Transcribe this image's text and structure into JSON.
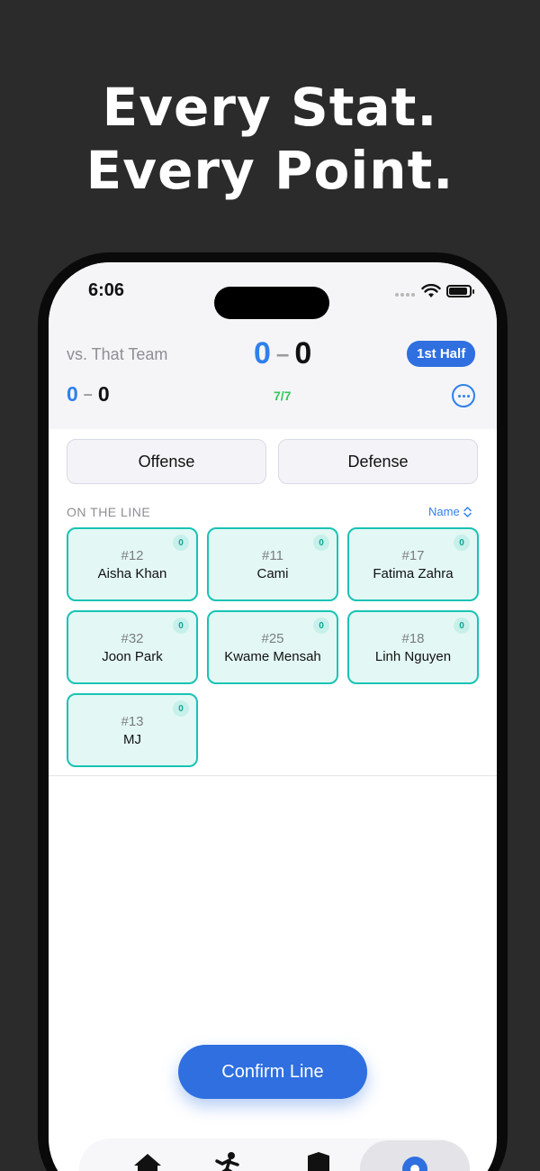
{
  "promo": {
    "line1": "Every Stat.",
    "line2": "Every Point."
  },
  "status_bar": {
    "time": "6:06"
  },
  "game": {
    "opponent": "vs. That Team",
    "score_ours": "0",
    "score_dash": "–",
    "score_theirs": "0",
    "period": "1st Half",
    "half_score_ours": "0",
    "half_score_dash": "–",
    "half_score_theirs": "0",
    "players_count": "7/7"
  },
  "modes": {
    "offense": "Offense",
    "defense": "Defense"
  },
  "line": {
    "label": "ON THE LINE",
    "sort_label": "Name",
    "players": [
      {
        "number": "#12",
        "name": "Aisha Khan",
        "points": "0"
      },
      {
        "number": "#11",
        "name": "Cami",
        "points": "0"
      },
      {
        "number": "#17",
        "name": "Fatima Zahra",
        "points": "0"
      },
      {
        "number": "#32",
        "name": "Joon Park",
        "points": "0"
      },
      {
        "number": "#25",
        "name": "Kwame Mensah",
        "points": "0"
      },
      {
        "number": "#18",
        "name": "Linh Nguyen",
        "points": "0"
      },
      {
        "number": "#13",
        "name": "MJ",
        "points": "0"
      }
    ]
  },
  "actions": {
    "confirm": "Confirm Line"
  },
  "colors": {
    "accent": "#2f6fe0",
    "score_blue": "#2f80ed",
    "card_border": "#19c3b4",
    "card_fill": "#e3f8f5",
    "count_green": "#34c759"
  },
  "tabbar": {
    "icons": [
      "home-icon",
      "player-kick-icon",
      "shield-icon",
      "location-pin-icon"
    ]
  }
}
